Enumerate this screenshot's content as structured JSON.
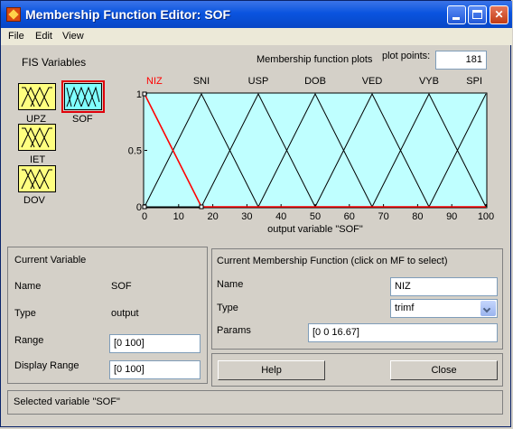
{
  "window": {
    "title": "Membership Function Editor: SOF"
  },
  "menu": [
    "File",
    "Edit",
    "View"
  ],
  "fis": {
    "title": "FIS Variables",
    "variables": [
      {
        "name": "UPZ",
        "kind": "input",
        "selected": false
      },
      {
        "name": "SOF",
        "kind": "output",
        "selected": true
      },
      {
        "name": "IET",
        "kind": "input",
        "selected": false
      },
      {
        "name": "DOV",
        "kind": "input",
        "selected": false
      }
    ]
  },
  "plot": {
    "title": "Membership function plots",
    "points_label": "plot points:",
    "points_value": "181",
    "xlabel": "output variable \"SOF\""
  },
  "chart_data": {
    "type": "line",
    "xlabel": "output variable \"SOF\"",
    "xlim": [
      0,
      100
    ],
    "ylim": [
      0,
      1
    ],
    "xticks": [
      0,
      10,
      20,
      30,
      40,
      50,
      60,
      70,
      80,
      90,
      100
    ],
    "yticks": [
      0,
      0.5,
      1
    ],
    "series": [
      {
        "name": "NIZ",
        "params": [
          0,
          0,
          16.67
        ],
        "color": "#ff0000",
        "selected": true
      },
      {
        "name": "SNI",
        "params": [
          0,
          16.67,
          33.33
        ],
        "color": "#000000"
      },
      {
        "name": "USP",
        "params": [
          16.67,
          33.33,
          50
        ],
        "color": "#000000"
      },
      {
        "name": "DOB",
        "params": [
          33.33,
          50,
          66.67
        ],
        "color": "#000000"
      },
      {
        "name": "VED",
        "params": [
          50,
          66.67,
          83.33
        ],
        "color": "#000000"
      },
      {
        "name": "VYB",
        "params": [
          66.67,
          83.33,
          100
        ],
        "color": "#000000"
      },
      {
        "name": "SPI",
        "params": [
          83.33,
          100,
          100
        ],
        "color": "#000000"
      }
    ]
  },
  "current_variable": {
    "title": "Current Variable",
    "name_label": "Name",
    "name_value": "SOF",
    "type_label": "Type",
    "type_value": "output",
    "range_label": "Range",
    "range_value": "[0 100]",
    "display_range_label": "Display Range",
    "display_range_value": "[0 100]"
  },
  "current_mf": {
    "title": "Current Membership Function (click on MF to select)",
    "name_label": "Name",
    "name_value": "NIZ",
    "type_label": "Type",
    "type_value": "trimf",
    "params_label": "Params",
    "params_value": "[0 0 16.67]"
  },
  "buttons": {
    "help": "Help",
    "close": "Close"
  },
  "status": "Selected variable \"SOF\""
}
